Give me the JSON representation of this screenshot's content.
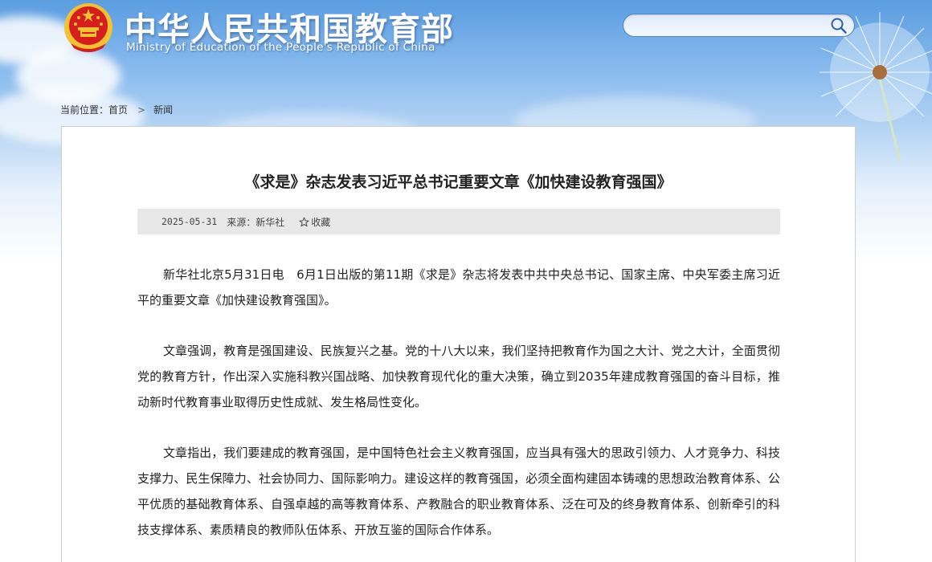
{
  "header": {
    "title_cn": "中华人民共和国教育部",
    "title_en": "Ministry of Education of the People's Republic of China",
    "emblem_icon": "national-emblem-icon",
    "search_icon": "search-icon",
    "search_value": ""
  },
  "breadcrumb": {
    "prefix": "当前位置：",
    "home": "首页",
    "current": "新闻"
  },
  "article": {
    "title": "《求是》杂志发表习近平总书记重要文章《加快建设教育强国》",
    "date": "2025-05-31",
    "source": "来源：新华社",
    "favorite_label": "收藏",
    "paragraphs": [
      "新华社北京5月31日电　6月1日出版的第11期《求是》杂志将发表中共中央总书记、国家主席、中央军委主席习近平的重要文章《加快建设教育强国》。",
      "文章强调，教育是强国建设、民族复兴之基。党的十八大以来，我们坚持把教育作为国之大计、党之大计，全面贯彻党的教育方针，作出深入实施科教兴国战略、加快教育现代化的重大决策，确立到2035年建成教育强国的奋斗目标，推动新时代教育事业取得历史性成就、发生格局性变化。",
      "文章指出，我们要建成的教育强国，是中国特色社会主义教育强国，应当具有强大的思政引领力、人才竞争力、科技支撑力、民生保障力、社会协同力、国际影响力。建设这样的教育强国，必须全面构建固本铸魂的思想政治教育体系、公平优质的基础教育体系、自强卓越的高等教育体系、产教融合的职业教育体系、泛在可及的终身教育体系、创新牵引的科技支撑体系、素质精良的教师队伍体系、开放互鉴的国际合作体系。"
    ]
  },
  "colors": {
    "sky_top": "#5b9de0",
    "title_text": "#222222",
    "meta_bg": "#e8e8e8",
    "search_border": "#4f86cc",
    "emblem_red": "#d71e1e",
    "emblem_gold": "#f2c230"
  }
}
